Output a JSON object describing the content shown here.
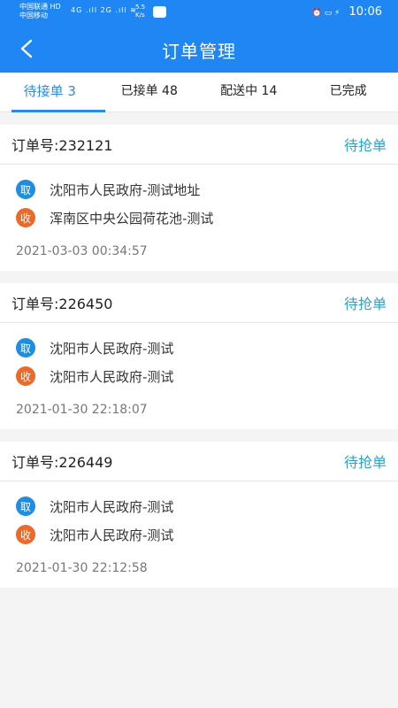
{
  "status_bar": {
    "carrier1": "中国联通 HD",
    "carrier2": "中国移动",
    "signal_icons": "4G .ıll 2G .ıll ≋",
    "net_speed_value": "5.5",
    "net_speed_unit": "K/s",
    "right_icons": "⏰ ▭ ⚡",
    "time": "10:06"
  },
  "header": {
    "title": "订单管理"
  },
  "tabs": [
    {
      "label": "待接单 3"
    },
    {
      "label": "已接单 48"
    },
    {
      "label": "配送中 14"
    },
    {
      "label": "已完成"
    }
  ],
  "orders": [
    {
      "number_label": "订单号:232121",
      "status": "待抢单",
      "pickup_badge": "取",
      "pickup_address": "沈阳市人民政府-测试地址",
      "dropoff_badge": "收",
      "dropoff_address": "浑南区中央公园荷花池-测试",
      "time": "2021-03-03 00:34:57"
    },
    {
      "number_label": "订单号:226450",
      "status": "待抢单",
      "pickup_badge": "取",
      "pickup_address": "沈阳市人民政府-测试",
      "dropoff_badge": "收",
      "dropoff_address": "沈阳市人民政府-测试",
      "time": "2021-01-30 22:18:07"
    },
    {
      "number_label": "订单号:226449",
      "status": "待抢单",
      "pickup_badge": "取",
      "pickup_address": "沈阳市人民政府-测试",
      "dropoff_badge": "收",
      "dropoff_address": "沈阳市人民政府-测试",
      "time": "2021-01-30 22:12:58"
    }
  ],
  "colors": {
    "primary": "#1f86f3",
    "tab_active": "#2a8de3",
    "status": "#2aa5c9",
    "pickup_badge": "#1f8ee0",
    "dropoff_badge": "#ea6a2c"
  }
}
